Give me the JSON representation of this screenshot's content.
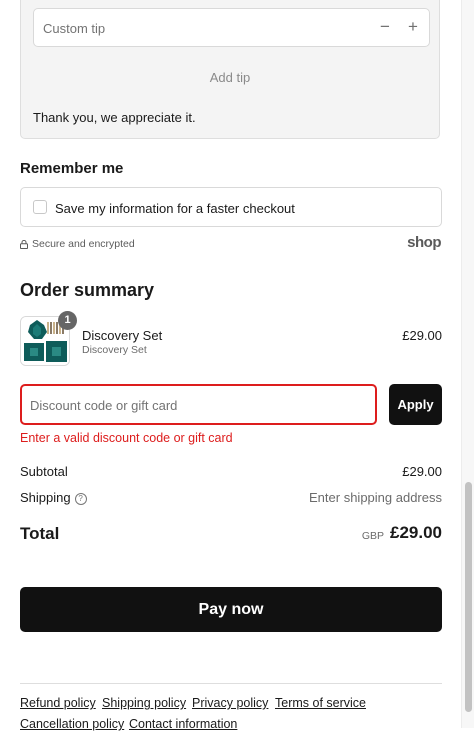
{
  "tip": {
    "custom_placeholder": "Custom tip",
    "minus_symbol": "−",
    "plus_symbol": "+",
    "add_tip_label": "Add tip",
    "thanks_text": "Thank you, we appreciate it."
  },
  "remember": {
    "heading": "Remember me",
    "save_label": "Save my information for a faster checkout",
    "checked": false
  },
  "security": {
    "icon": "lock-icon",
    "text": "Secure and encrypted",
    "brand_logo_text": "shop"
  },
  "order_summary": {
    "heading": "Order summary",
    "items": [
      {
        "name": "Discovery Set",
        "variant": "Discovery Set",
        "quantity": "1",
        "price": "£29.00"
      }
    ]
  },
  "discount": {
    "placeholder": "Discount code or gift card",
    "apply_label": "Apply",
    "error": "Enter a valid discount code or gift card"
  },
  "totals": {
    "subtotal_label": "Subtotal",
    "subtotal_value": "£29.00",
    "shipping_label": "Shipping",
    "shipping_help_icon": "question-circle-icon",
    "shipping_value": "Enter shipping address",
    "total_label": "Total",
    "currency": "GBP",
    "total_value": "£29.00"
  },
  "pay": {
    "label": "Pay now"
  },
  "footer": {
    "links": [
      "Refund policy",
      "Shipping policy",
      "Privacy policy",
      "Terms of service",
      "Cancellation policy",
      "Contact information"
    ]
  },
  "colors": {
    "error": "#dd1d1d",
    "primary_button": "#111111",
    "product_teal": "#0e5c5a"
  }
}
